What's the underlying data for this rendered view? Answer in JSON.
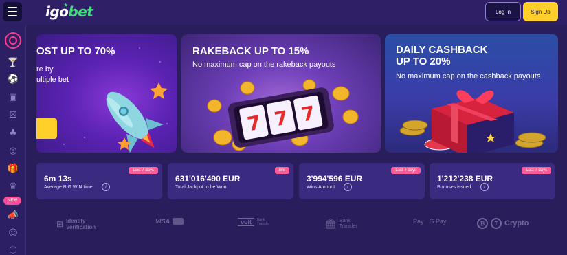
{
  "header": {
    "logo_part1": "igo",
    "logo_part2": "bet",
    "login_label": "Log In",
    "signup_label": "Sign Up"
  },
  "sidebar": {
    "new_badge": "NEW"
  },
  "promos": [
    {
      "title_line1": "OST UP TO 70%",
      "sub_line1": "re by",
      "sub_line2": "ultiple bet"
    },
    {
      "title_line1": "RAKEBACK UP TO 15%",
      "sub_line1": "No maximum cap on the rakeback payouts"
    },
    {
      "title_line1": "DAILY CASHBACK",
      "title_line2": "UP TO 20%",
      "sub_line1": "No maximum cap on the cashback payouts"
    }
  ],
  "stats": [
    {
      "badge": "Last 7 days",
      "value": "6m 13s",
      "label": "Average BIG WIN time"
    },
    {
      "badge": "live",
      "value": "631'016'490 EUR",
      "label": "Total Jackpot to be Won"
    },
    {
      "badge": "Last 7 days",
      "value": "3'994'596 EUR",
      "label": "Wins Amount"
    },
    {
      "badge": "Last 7 days",
      "value": "1'212'238 EUR",
      "label": "Bonuses issued"
    }
  ],
  "payments": {
    "identity_top": "Identity",
    "identity_bottom": "Verification",
    "visa": "VISA",
    "volt": "volt",
    "volt_sub": "Bank Transfer",
    "bank_top": "Bank",
    "bank_bottom": "Transfer",
    "applepay": "Pay",
    "googlepay": "G Pay",
    "crypto": "Crypto"
  },
  "colors": {
    "brand_green": "#3ee07a",
    "accent_yellow": "#ffd02a",
    "badge_pink": "#ff5a9a",
    "background": "#2a1d5c"
  }
}
